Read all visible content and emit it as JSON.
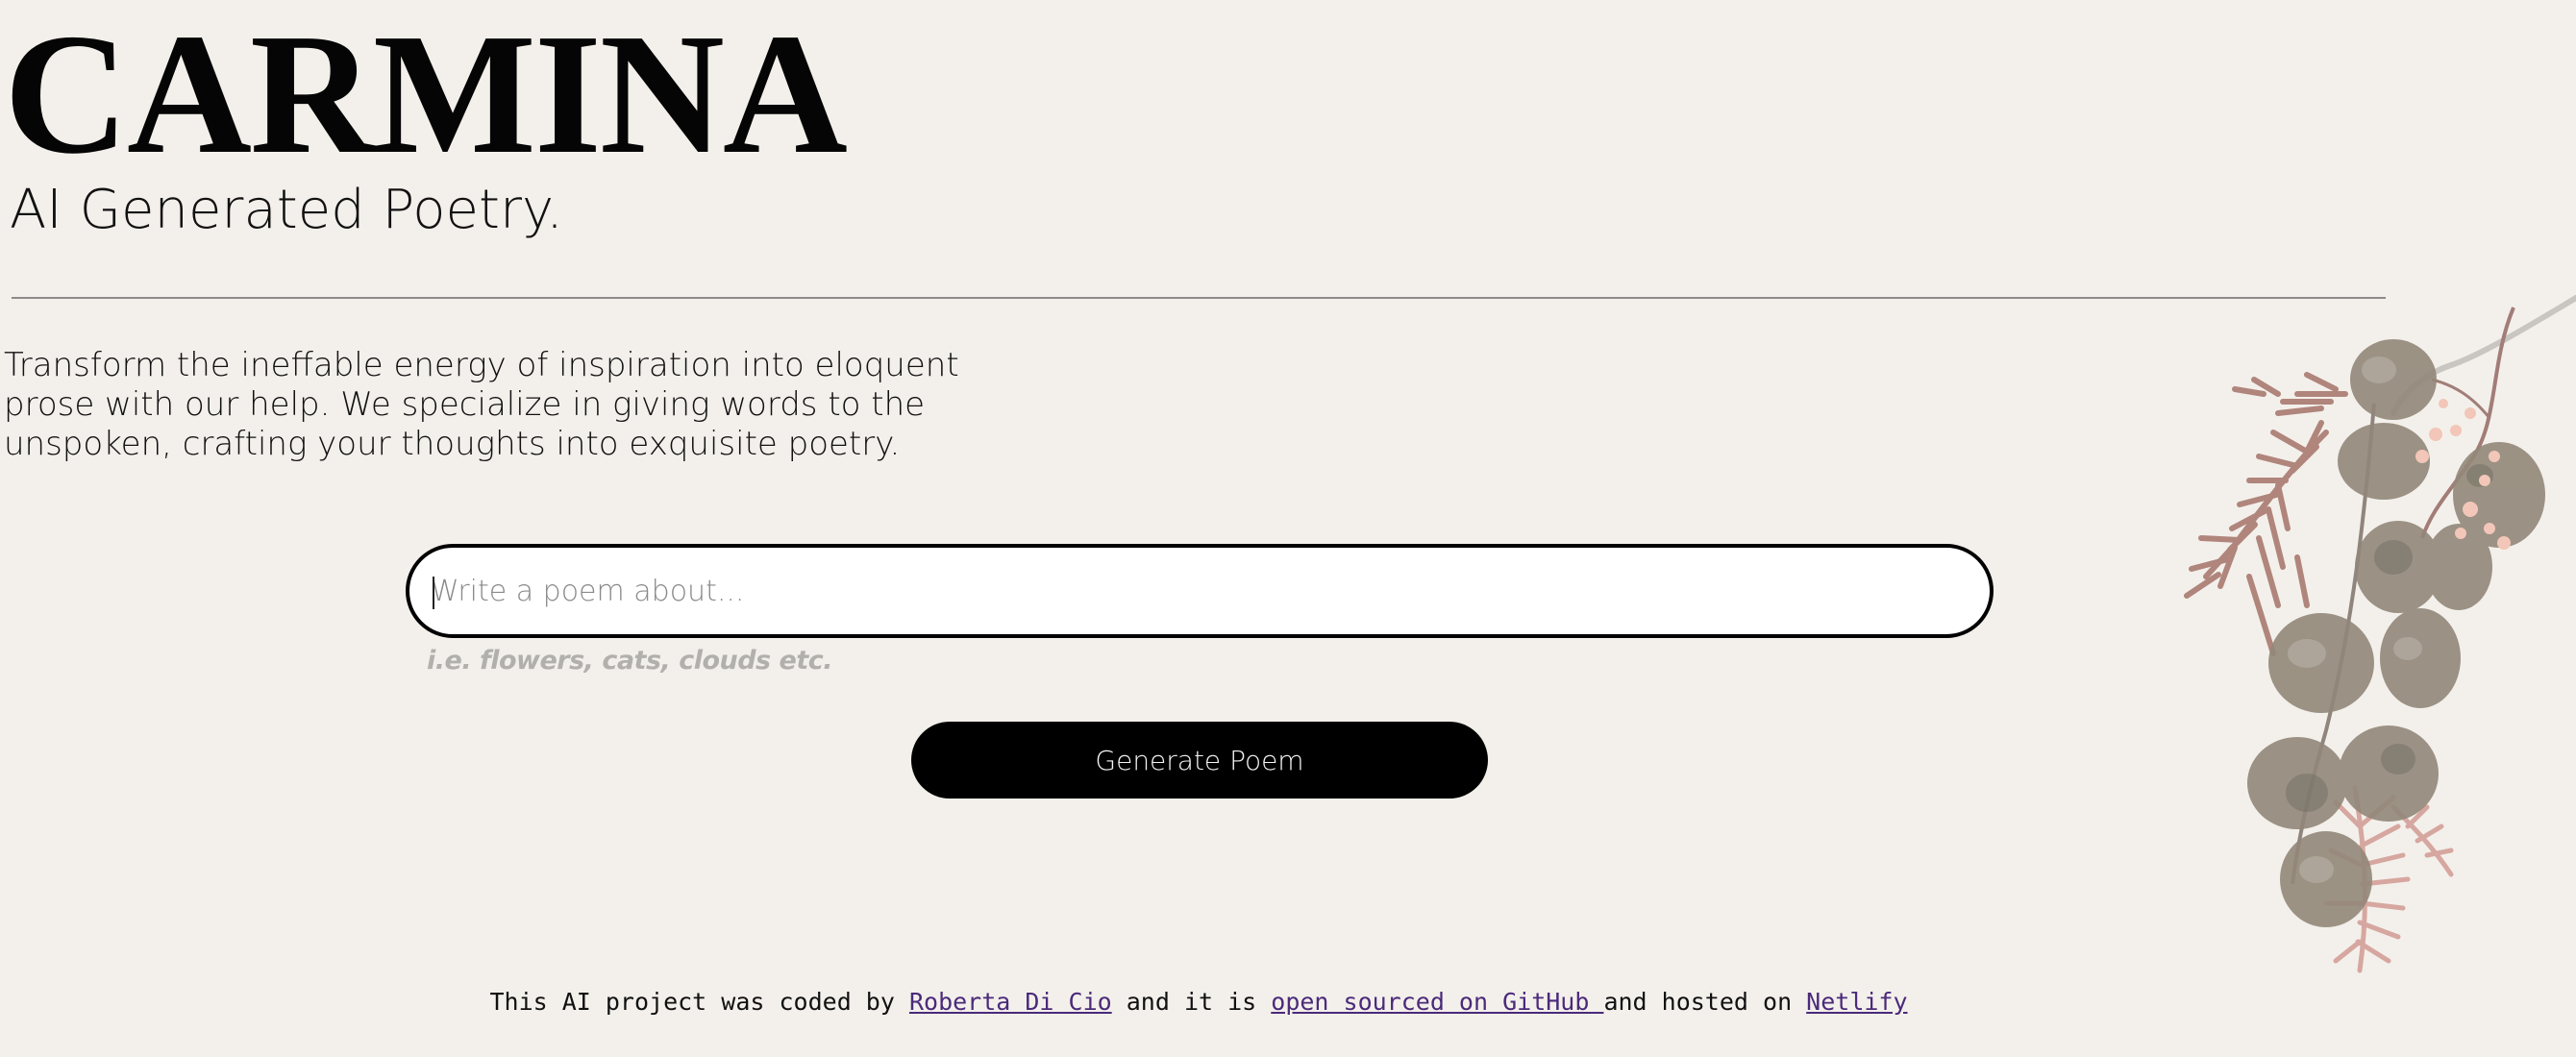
{
  "header": {
    "brand": "CARMINA",
    "tagline": "AI Generated Poetry."
  },
  "intro": {
    "text": "Transform the ineffable energy of inspiration into eloquent prose with our help. We specialize in giving words to the unspoken, crafting your thoughts into exquisite poetry."
  },
  "form": {
    "input_placeholder": "Write a poem about...",
    "input_value": "",
    "hint": "i.e. flowers, cats, clouds etc.",
    "submit_label": "Generate Poem"
  },
  "footer": {
    "text_1": "This AI project was coded by ",
    "author_link": "Roberta Di Cio",
    "text_2": " and it is ",
    "github_link": "open sourced on GitHub ",
    "text_3": "and hosted on ",
    "netlify_link": "Netlify"
  },
  "decor": {
    "icon": "eucalyptus-branch-icon",
    "leaf_color": "#8d8276",
    "leaf_dark_color": "#6d6a60",
    "fern_color": "#b0857c",
    "berry_color": "#f2c6b8",
    "stem_color": "#9b7c78"
  },
  "colors": {
    "background": "#f3f0eb",
    "button": "#000000",
    "link": "#4b2a7a",
    "hint": "#b2b0ad",
    "divider": "#8f8a8a"
  }
}
